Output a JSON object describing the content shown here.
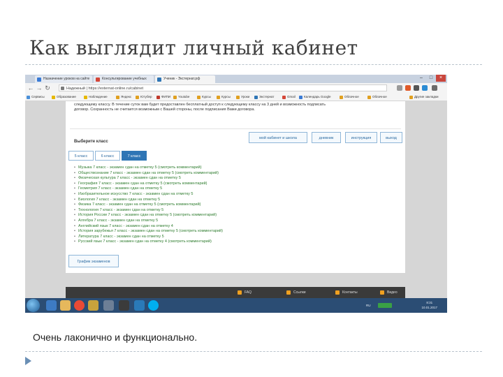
{
  "slide": {
    "title": "Как выглядит личный кабинет",
    "caption": "Очень лаконично и функционально."
  },
  "browser": {
    "tabs": [
      "Назначение уроков на сайте",
      "Консультирование учебных",
      "Ученик - Экстернат.рф"
    ],
    "address": "Надежный  |  https://externat-online.ru/cabinet",
    "bookmarks": [
      "Сервисы",
      "Образование",
      "Наблюдение",
      "Яндекс",
      "Ютубер",
      "ФИПИ",
      "Youtube",
      "Курсы",
      "Курсы",
      "Уроки",
      "Экстернат",
      "Gmail",
      "Календарь Google",
      "Облачное",
      "Облачное",
      "Другие закладки"
    ]
  },
  "page": {
    "notice_lines": [
      "следующему классу. В течение суток вам будет предоставлен бесплатный доступ к следующему классу на 3 дней и возможность подписать",
      "договор. Сохранность не считается возможным с Вашей стороны, после подписания Вами договора."
    ],
    "top_buttons": [
      "мой кабинет и школа",
      "дневник",
      "инструкция",
      "выход"
    ],
    "grade_title": "Выберите класс",
    "class_tabs": [
      "5 класс",
      "6 класс",
      "7 класс"
    ],
    "subjects": [
      "Музыка 7 класс - экзамен сдан на отметку 5 (смотреть комментарий)",
      "Обществознание 7 класс - экзамен сдан на отметку 5 (смотреть комментарий)",
      "Физическая культура 7 класс - экзамен сдан на отметку 5",
      "География 7 класс - экзамен сдан на отметку 5 (смотреть комментарий)",
      "Геометрия 7 класс - экзамен сдан на отметку 5",
      "Изобразительное искусство 7 класс - экзамен сдан на отметку 5",
      "Биология 7 класс - экзамен сдан на отметку 5",
      "Физика 7 класс - экзамен сдан на отметку 5 (смотреть комментарий)",
      "Технология 7 класс - экзамен сдан на отметку 5",
      "История России 7 класс - экзамен сдан на отметку 5 (смотреть комментарий)",
      "Алгебра 7 класс - экзамен сдан на отметку 5",
      "Английский язык 7 класс - экзамен сдан на отметку 4",
      "История зарубежья 7 класс - экзамен сдан на отметку 5 (смотреть комментарий)",
      "Литература 7 класс - экзамен сдан на отметку 5",
      "Русский язык 7 класс - экзамен сдан на отметку 4 (смотреть комментарий)"
    ],
    "schedule_button": "График экзаменов",
    "footer_items": [
      "FAQ",
      "Ссылки",
      "Контакты",
      "Видео"
    ]
  },
  "taskbar": {
    "lang": "RU",
    "time": "8:31",
    "date": "10.01.2017"
  },
  "colors": {
    "accent": "#2f75b5",
    "link_green": "#2f7d2f",
    "taskbar": "#2b4d74"
  }
}
